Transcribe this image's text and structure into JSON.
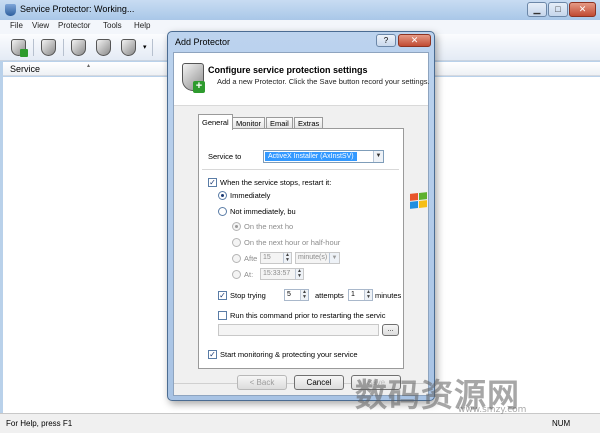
{
  "main": {
    "title": "Service Protector: Working...",
    "menu": [
      "File",
      "View",
      "Protector",
      "Tools",
      "Help"
    ],
    "list_header": "Service",
    "status_text": "For Help, press F1",
    "status_num": "NUM"
  },
  "dialog": {
    "title": "Add Protector",
    "help_label": "?",
    "close_label": "✕",
    "header_title": "Configure service protection settings",
    "header_sub": "Add a new Protector. Click the Save button record your settings.",
    "tabs": [
      "General",
      "Monitor",
      "Email",
      "Extras"
    ],
    "service_label": "Service to",
    "service_value": "ActiveX Installer (AxInstSV)",
    "restart_label": "When the service stops, restart it:",
    "immediately": "Immediately",
    "not_immediately": "Not immediately, bu",
    "on_next_ho": "On the next ho",
    "on_next_hour_or_half": "On the next hour or half-hour",
    "after_label": "Afte",
    "after_value": "15",
    "after_unit": "minute(s)",
    "at_label": "At:",
    "at_value": "15:33:57",
    "stop_trying_label": "Stop trying",
    "stop_trying_value": "5",
    "attempts_label": "attempts",
    "minutes_value": "1",
    "minutes_label": "minutes",
    "run_command_label": "Run this command prior to restarting the servic",
    "browse_label": "...",
    "start_monitoring_label": "Start monitoring & protecting your service",
    "back_label": "< Back",
    "cancel_label": "Cancel",
    "save_label": "Save"
  },
  "watermark": {
    "text": "数码资源网",
    "sub": "www.smzy.com"
  },
  "colors": {
    "selection": "#3399ff",
    "desktop": "#b9d1ea",
    "dialog_frame": "#a8c3e4"
  }
}
